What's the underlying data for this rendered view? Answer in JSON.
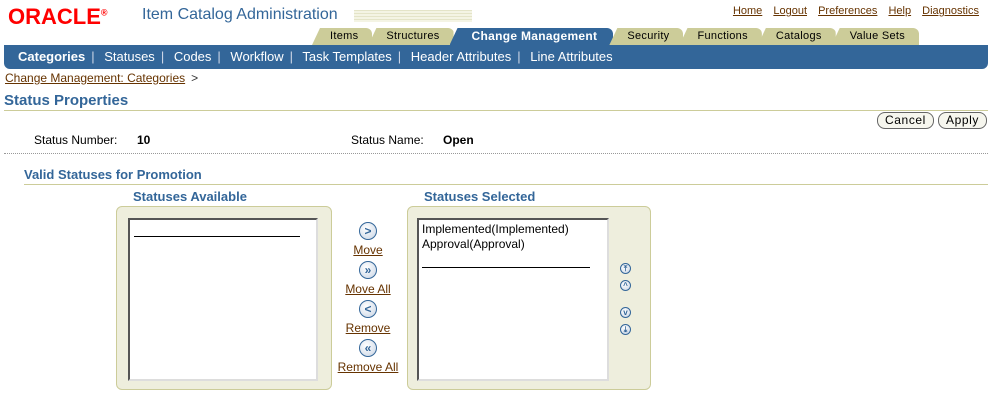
{
  "header": {
    "brand": "ORACLE",
    "app_title": "Item Catalog Administration",
    "global_links": [
      "Home",
      "Logout",
      "Preferences",
      "Help",
      "Diagnostics"
    ]
  },
  "tabs": [
    {
      "label": "Items",
      "active": false
    },
    {
      "label": "Structures",
      "active": false
    },
    {
      "label": "Change Management",
      "active": true
    },
    {
      "label": "Security",
      "active": false
    },
    {
      "label": "Functions",
      "active": false
    },
    {
      "label": "Catalogs",
      "active": false
    },
    {
      "label": "Value Sets",
      "active": false
    }
  ],
  "subnav": [
    "Categories",
    "Statuses",
    "Codes",
    "Workflow",
    "Task Templates",
    "Header Attributes",
    "Line Attributes"
  ],
  "breadcrumb": {
    "link": "Change Management: Categories",
    "arrow": ">"
  },
  "page": {
    "title": "Status Properties",
    "cancel_label": "Cancel",
    "apply_label": "Apply",
    "status_number_label": "Status Number:",
    "status_number_value": "10",
    "status_name_label": "Status Name:",
    "status_name_value": "Open"
  },
  "section": {
    "title": "Valid Statuses for Promotion",
    "available_title": "Statuses Available",
    "selected_title": "Statuses Selected",
    "available_items": [],
    "selected_items": [
      "Implemented(Implemented)",
      "Approval(Approval)"
    ]
  },
  "shuttle": {
    "move": "Move",
    "move_all": "Move All",
    "remove": "Remove",
    "remove_all": "Remove All"
  },
  "icons": {
    "move": "move-right-icon",
    "move_all": "move-all-right-icon",
    "remove": "move-left-icon",
    "remove_all": "remove-all-left-icon",
    "order": [
      "move-to-top-icon",
      "move-up-icon",
      "move-down-icon",
      "move-to-bottom-icon"
    ]
  },
  "colors": {
    "brand_red": "#ff0000",
    "accent_blue": "#336699",
    "tab_tan": "#cccc99",
    "link_brown": "#663300"
  }
}
